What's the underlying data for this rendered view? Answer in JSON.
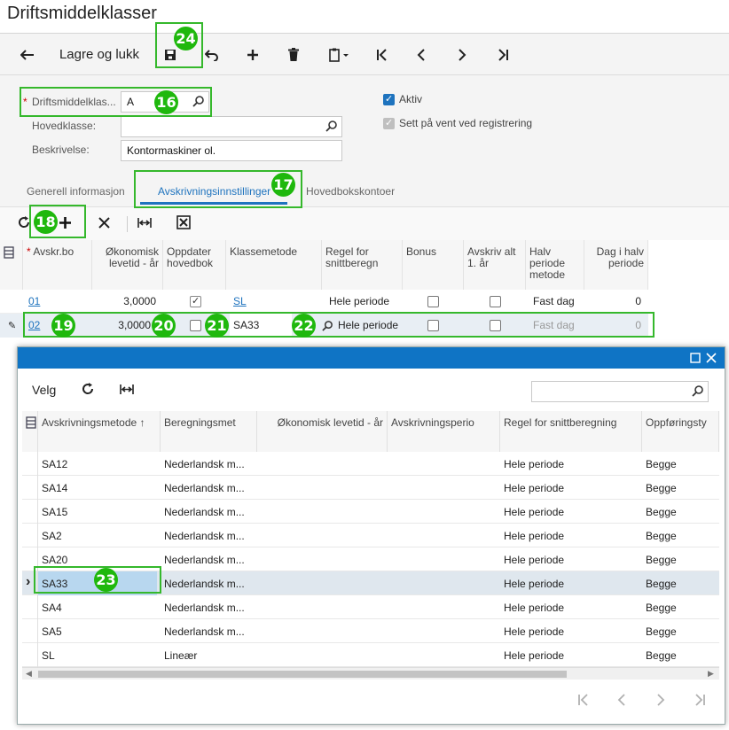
{
  "page": {
    "title": "Driftsmiddelklasser"
  },
  "toolbar": {
    "back_icon": "arrow-left-icon",
    "save_close_label": "Lagre og lukk",
    "icons": [
      "save-icon",
      "undo-icon",
      "plus-icon",
      "trash-icon",
      "clipboard-icon",
      "first-page-icon",
      "prev-icon",
      "next-icon",
      "last-page-icon"
    ]
  },
  "form": {
    "class_label": "Driftsmiddelklas...",
    "class_value": "A",
    "main_class_label": "Hovedklasse:",
    "main_class_value": "",
    "description_label": "Beskrivelse:",
    "description_value": "Kontormaskiner ol.",
    "active_label": "Aktiv",
    "active_checked": true,
    "hold_label": "Sett på vent ved registrering",
    "hold_checked": true
  },
  "tabs": [
    {
      "label": "Generell informasjon",
      "active": false
    },
    {
      "label": "Avskrivningsinnstillinger",
      "active": true
    },
    {
      "label": "Hovedbokskontoer",
      "active": false
    }
  ],
  "grid": {
    "columns": [
      "Avskr.bo",
      "Økonomisk levetid - år",
      "Oppdater hovedbok",
      "Klassemetode",
      "Regel for snittberegn",
      "Bonus",
      "Avskriv alt 1. år",
      "Halv periode metode",
      "Dag i halv periode"
    ],
    "rows": [
      {
        "book": "01",
        "life": "3,0000",
        "update": true,
        "method": "SL",
        "rule": "Hele periode",
        "bonus": false,
        "all_first": false,
        "half": "Fast dag",
        "day": "0"
      },
      {
        "book": "02",
        "life": "3,0000",
        "update": false,
        "method": "SA33",
        "rule": "Hele periode",
        "bonus": false,
        "all_first": false,
        "half": "Fast dag",
        "day": "0"
      }
    ]
  },
  "popup": {
    "select_label": "Velg",
    "search_value": "",
    "columns": [
      "Avskrivningsmetode",
      "Beregningsmet",
      "Økonomisk levetid - år",
      "Avskrivningsperio",
      "Regel for snittberegning",
      "Oppføringsty"
    ],
    "rows": [
      {
        "method": "SA12",
        "calc": "Nederlandsk m...",
        "life": "",
        "period": "",
        "rule": "Hele periode",
        "entry": "Begge"
      },
      {
        "method": "SA14",
        "calc": "Nederlandsk m...",
        "life": "",
        "period": "",
        "rule": "Hele periode",
        "entry": "Begge"
      },
      {
        "method": "SA15",
        "calc": "Nederlandsk m...",
        "life": "",
        "period": "",
        "rule": "Hele periode",
        "entry": "Begge"
      },
      {
        "method": "SA2",
        "calc": "Nederlandsk m...",
        "life": "",
        "period": "",
        "rule": "Hele periode",
        "entry": "Begge"
      },
      {
        "method": "SA20",
        "calc": "Nederlandsk m...",
        "life": "",
        "period": "",
        "rule": "Hele periode",
        "entry": "Begge"
      },
      {
        "method": "SA33",
        "calc": "Nederlandsk m...",
        "life": "",
        "period": "",
        "rule": "Hele periode",
        "entry": "Begge"
      },
      {
        "method": "SA4",
        "calc": "Nederlandsk m...",
        "life": "",
        "period": "",
        "rule": "Hele periode",
        "entry": "Begge"
      },
      {
        "method": "SA5",
        "calc": "Nederlandsk m...",
        "life": "",
        "period": "",
        "rule": "Hele periode",
        "entry": "Begge"
      },
      {
        "method": "SL",
        "calc": "Lineær",
        "life": "",
        "period": "",
        "rule": "Hele periode",
        "entry": "Begge"
      }
    ],
    "selected_index": 5
  },
  "callouts": [
    "24",
    "16",
    "17",
    "18",
    "19",
    "20",
    "21",
    "22",
    "23"
  ],
  "colors": {
    "accent": "#1e73be",
    "callout": "#35b82c",
    "badge": "#1fb80d",
    "popup_header": "#0f74c5",
    "selected_row": "#dfe7ee",
    "selected_cell": "#b8d7ef"
  }
}
